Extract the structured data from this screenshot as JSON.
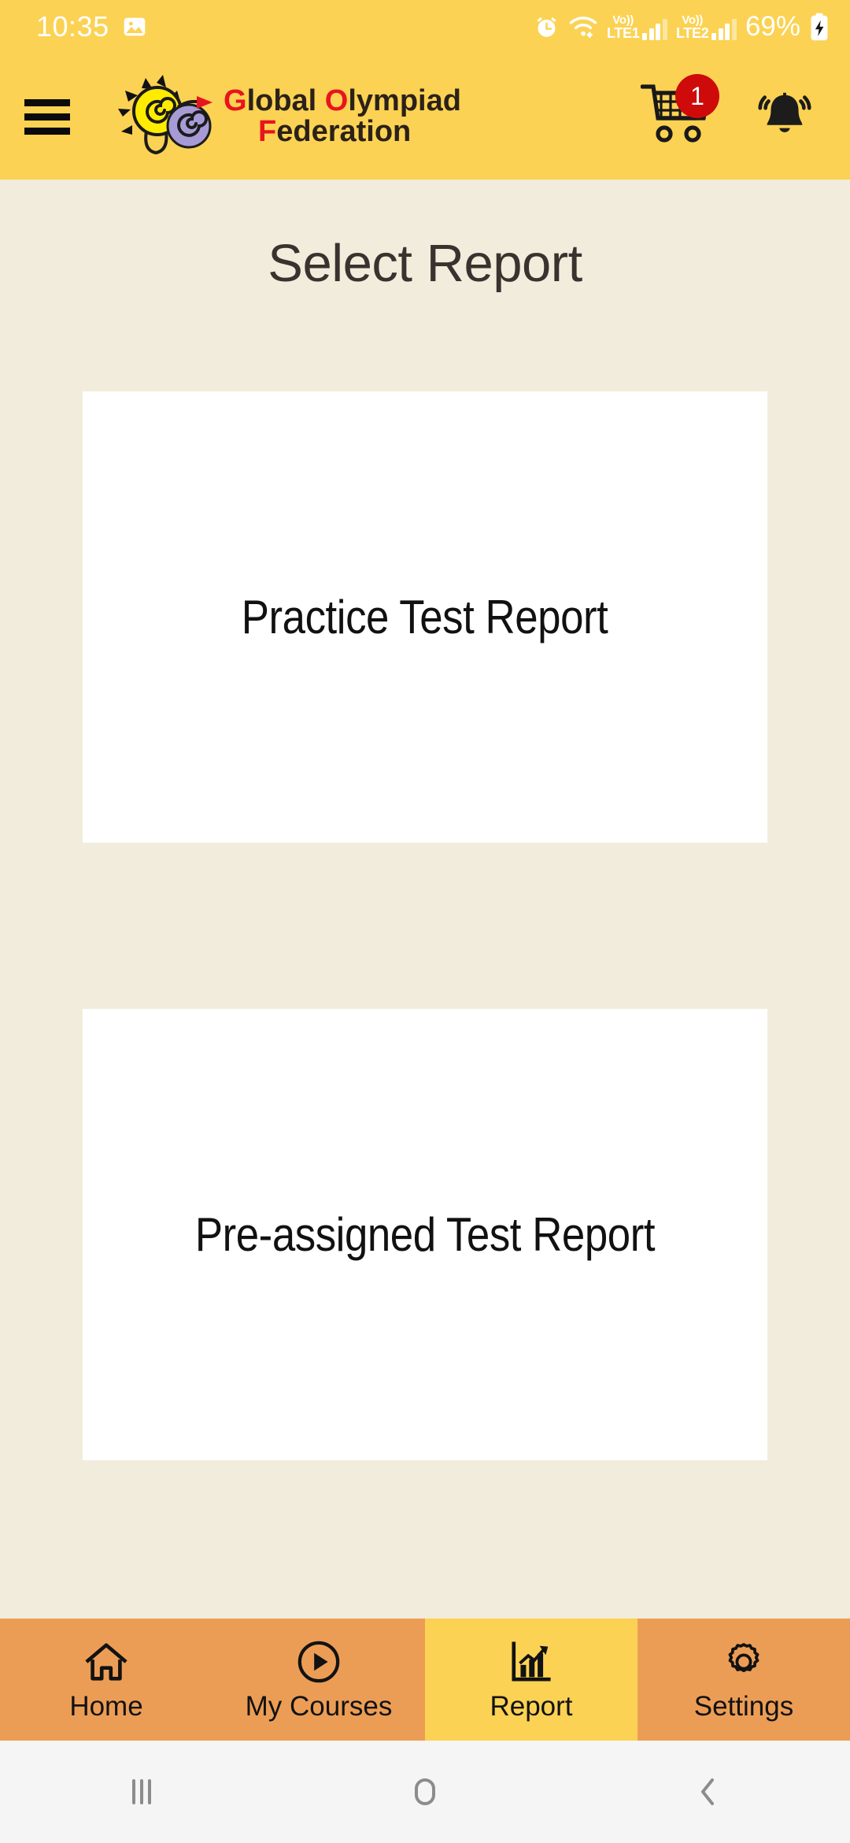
{
  "status_bar": {
    "time": "10:35",
    "left_icons": [
      "image-icon"
    ],
    "right_icons": [
      "alarm-icon",
      "wifi-icon"
    ],
    "sim1": {
      "volte": "Vo))",
      "network": "LTE1"
    },
    "sim2": {
      "volte": "Vo))",
      "network": "LTE2"
    },
    "battery_percent": "69%",
    "battery_state": "charging"
  },
  "header": {
    "menu_icon": "hamburger-menu-icon",
    "brand_line1_red": "G",
    "brand_line1_rest": "lobal ",
    "brand_line1_red2": "O",
    "brand_line1_rest2": "lympiad",
    "brand_line2_red": "F",
    "brand_line2_rest": "ederation",
    "cart_icon": "shopping-cart-icon",
    "cart_badge": "1",
    "bell_icon": "notification-bell-icon",
    "bg_color": "#FBD253"
  },
  "main": {
    "title": "Select Report",
    "cards": [
      {
        "label": "Practice Test Report"
      },
      {
        "label": "Pre-assigned Test Report"
      }
    ],
    "bg_color": "#F2ECDC",
    "card_bg_color": "#FFFFFF"
  },
  "tabbar": {
    "active_color": "#FBD253",
    "inactive_color": "#EC9D55",
    "tabs": [
      {
        "label": "Home",
        "icon": "home-icon",
        "active": false
      },
      {
        "label": "My Courses",
        "icon": "play-circle-icon",
        "active": false
      },
      {
        "label": "Report",
        "icon": "bar-chart-icon",
        "active": true
      },
      {
        "label": "Settings",
        "icon": "gear-icon",
        "active": false
      }
    ]
  },
  "system_nav": {
    "recents": "recents-icon",
    "home": "home-square-icon",
    "back": "back-chevron-icon"
  }
}
